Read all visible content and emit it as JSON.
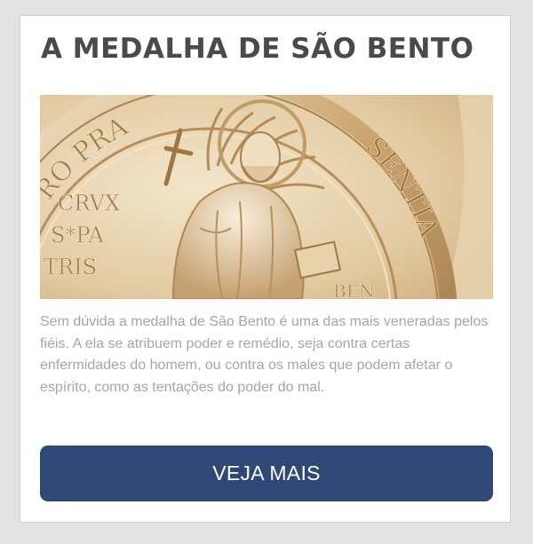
{
  "card": {
    "title": "A MEDALHA DE SÃO BENTO",
    "image": {
      "icon": "saint-benedict-medal-image",
      "inscriptions": {
        "arc_top": "RO PRA",
        "arc_right": "SENTIA",
        "cross_left_1": "CRVX",
        "cross_left_2": "S*PA",
        "cross_left_3": "TRIS",
        "bottom": "BEN"
      }
    },
    "description": "Sem dúvida a medalha de São Bento é uma das mais veneradas pelos fiéis. A ela se atribuem poder e remédio, seja contra certas enfermidades do homem, ou contra os males que podem afetar o espírito, como as tentações do poder do mal.",
    "button_label": "VEJA MAIS"
  },
  "colors": {
    "page_background": "#e3e3e3",
    "card_background": "#ffffff",
    "title": "#4a4a4a",
    "description": "#a6a6a6",
    "button": "#2f4878",
    "button_text": "#ffffff",
    "medal_gold": "#d2b387"
  }
}
